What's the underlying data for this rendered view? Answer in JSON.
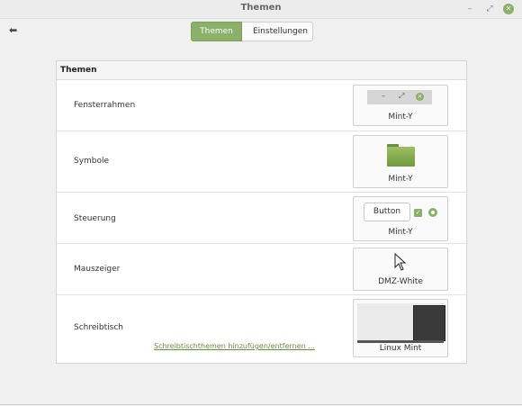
{
  "window": {
    "title": "Themen",
    "min_glyph": "–",
    "max_glyph": "⤢",
    "close_glyph": "✕"
  },
  "toolbar": {
    "back_glyph": "⬅",
    "tabs": [
      {
        "label": "Themen",
        "active": true
      },
      {
        "label": "Einstellungen",
        "active": false
      }
    ]
  },
  "panel": {
    "header": "Themen",
    "rows": [
      {
        "label": "Fensterrahmen",
        "choice": "Mint-Y"
      },
      {
        "label": "Symbole",
        "choice": "Mint-Y"
      },
      {
        "label": "Steuerung",
        "choice": "Mint-Y",
        "button_preview": "Button"
      },
      {
        "label": "Mauszeiger",
        "choice": "DMZ-White"
      },
      {
        "label": "Schreibtisch",
        "choice": "Linux Mint"
      }
    ],
    "link": "Schreibtischthemen hinzufügen/entfernen ..."
  },
  "icons": {
    "back": "arrow-left-icon",
    "folder": "folder-icon",
    "cursor": "mouse-pointer-icon",
    "check": "check-icon",
    "radio": "radio-icon"
  },
  "colors": {
    "accent": "#8ab06a",
    "folder": "#7fa84f"
  }
}
